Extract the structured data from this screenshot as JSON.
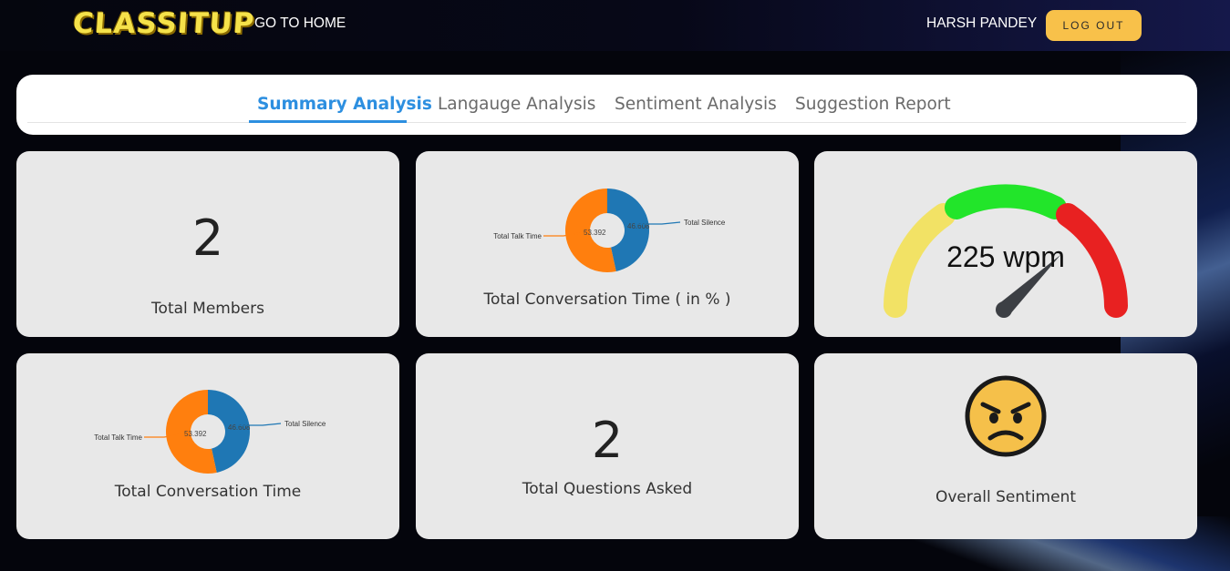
{
  "header": {
    "logo": "CLASSITUP",
    "home_link": "GO TO HOME",
    "user_name": "HARSH PANDEY",
    "logout_label": "LOG OUT"
  },
  "tabs": [
    {
      "label": "Summary Analysis",
      "active": true
    },
    {
      "label": "Langauge Analysis",
      "active": false
    },
    {
      "label": "Sentiment Analysis",
      "active": false
    },
    {
      "label": "Suggestion Report",
      "active": false
    }
  ],
  "cards": {
    "members": {
      "value": "2",
      "label": "Total Members"
    },
    "conversation_pct": {
      "label": "Total Conversation Time ( in % )"
    },
    "speed": {
      "value_text": "225 wpm",
      "value": 225,
      "colors": [
        "#f2e265",
        "#22e52a",
        "#e82121"
      ]
    },
    "conversation": {
      "label": "Total Conversation Time"
    },
    "questions": {
      "value": "2",
      "label": "Total Questions Asked"
    },
    "sentiment": {
      "label": "Overall Sentiment",
      "icon": "angry-face-icon"
    }
  },
  "chart_data": [
    {
      "type": "pie",
      "categories": [
        "Total Talk Time",
        "Total Silence"
      ],
      "values": [
        53.392,
        46.608
      ],
      "value_labels": [
        "53.392",
        "46.608"
      ],
      "colors": [
        "#ff7f0e",
        "#1f77b4"
      ]
    },
    {
      "type": "pie",
      "categories": [
        "Total Talk Time",
        "Total Silence"
      ],
      "values": [
        53.392,
        46.608
      ],
      "value_labels": [
        "53.392",
        "46.608"
      ],
      "colors": [
        "#ff7f0e",
        "#1f77b4"
      ]
    }
  ]
}
